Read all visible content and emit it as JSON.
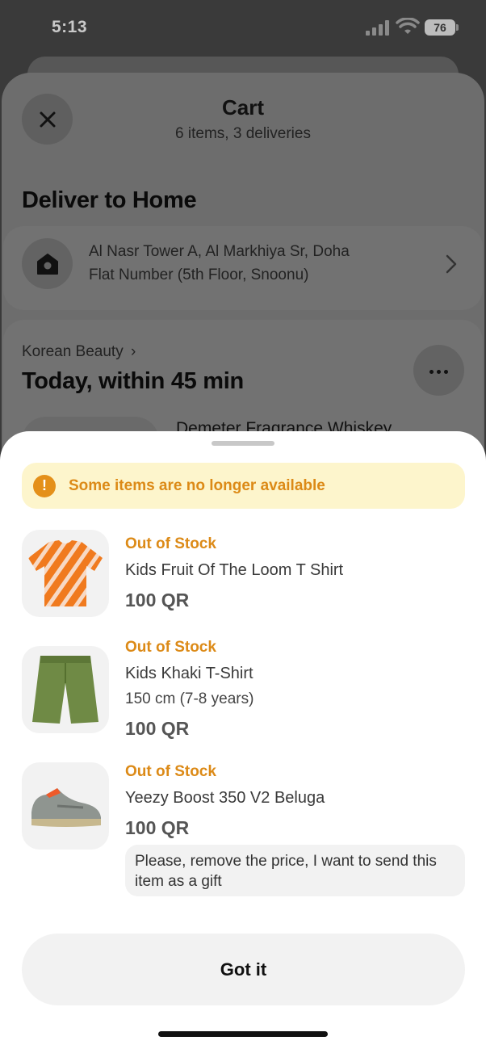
{
  "status_bar": {
    "time": "5:13",
    "battery": "76"
  },
  "cart": {
    "title": "Cart",
    "subtitle": "6 items, 3 deliveries",
    "deliver_title": "Deliver to Home",
    "address_line1": "Al Nasr Tower A, Al Markhiya Sr, Doha",
    "address_line2": "Flat Number (5th Floor, Snoonu)"
  },
  "delivery_group": {
    "store": "Korean Beauty",
    "store_chevron": "›",
    "when": "Today, within 45 min",
    "peek_item": "Demeter Fragrance Whiskey"
  },
  "sheet": {
    "warning": "Some items are no longer available",
    "warning_icon_glyph": "!",
    "items": [
      {
        "status": "Out of Stock",
        "name": "Kids Fruit Of The Loom T Shirt",
        "price": "100 QR",
        "icon": "orange-tshirt-icon"
      },
      {
        "status": "Out of Stock",
        "name": "Kids Khaki T-Shirt",
        "variant": "150 cm (7-8 years)",
        "price": "100 QR",
        "icon": "khaki-shorts-icon"
      },
      {
        "status": "Out of Stock",
        "name": "Yeezy Boost 350 V2 Beluga",
        "price": "100 QR",
        "note": "Please, remove the price, I want to send this item as a gift",
        "icon": "sneaker-icon"
      }
    ],
    "button": "Got it"
  },
  "colors": {
    "accent_orange": "#dc8a17",
    "warning_bg": "#fdf5cc",
    "overlay": "#6d6d6d"
  }
}
